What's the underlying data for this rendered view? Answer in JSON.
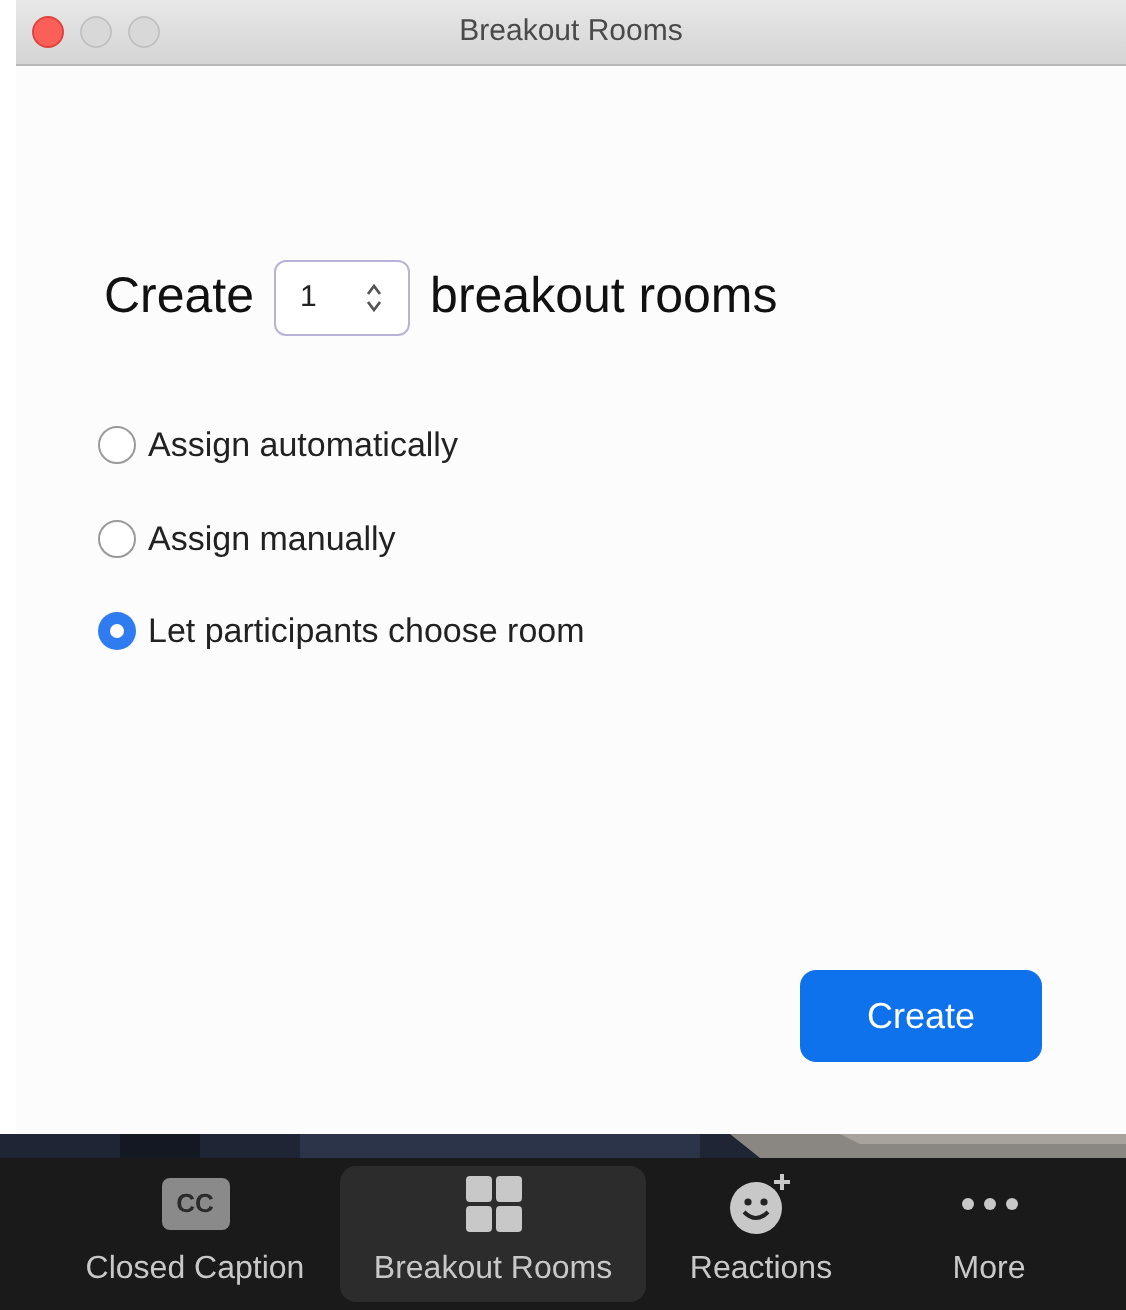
{
  "window": {
    "title": "Breakout Rooms"
  },
  "create_row": {
    "prefix": "Create",
    "count": "1",
    "suffix": "breakout rooms"
  },
  "options": [
    {
      "label": "Assign automatically",
      "selected": false
    },
    {
      "label": "Assign manually",
      "selected": false
    },
    {
      "label": "Let participants choose room",
      "selected": true
    }
  ],
  "create_button": "Create",
  "toolbar": [
    {
      "kind": "cc",
      "icon_text": "CC",
      "label": "Closed Caption",
      "selected": false
    },
    {
      "kind": "grid",
      "label": "Breakout Rooms",
      "selected": true
    },
    {
      "kind": "smile",
      "label": "Reactions",
      "selected": false
    },
    {
      "kind": "dots",
      "label": "More",
      "selected": false
    }
  ]
}
